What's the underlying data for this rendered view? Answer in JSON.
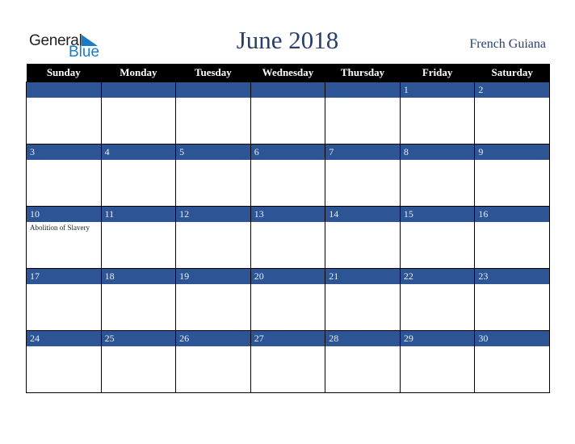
{
  "logo": {
    "general": "General",
    "blue": "Blue",
    "icon": "triangle-flag-icon"
  },
  "title": "June 2018",
  "region": "French Guiana",
  "weekdays": [
    "Sunday",
    "Monday",
    "Tuesday",
    "Wednesday",
    "Thursday",
    "Friday",
    "Saturday"
  ],
  "weeks": [
    [
      "",
      "",
      "",
      "",
      "",
      "1",
      "2"
    ],
    [
      "3",
      "4",
      "5",
      "6",
      "7",
      "8",
      "9"
    ],
    [
      "10",
      "11",
      "12",
      "13",
      "14",
      "15",
      "16"
    ],
    [
      "17",
      "18",
      "19",
      "20",
      "21",
      "22",
      "23"
    ],
    [
      "24",
      "25",
      "26",
      "27",
      "28",
      "29",
      "30"
    ]
  ],
  "events": {
    "10": "Abolition of Slavery"
  },
  "colors": {
    "date_bar": "#2d5595",
    "title": "#283f6b",
    "header": "#000000",
    "logo_blue": "#1a7cc4"
  }
}
